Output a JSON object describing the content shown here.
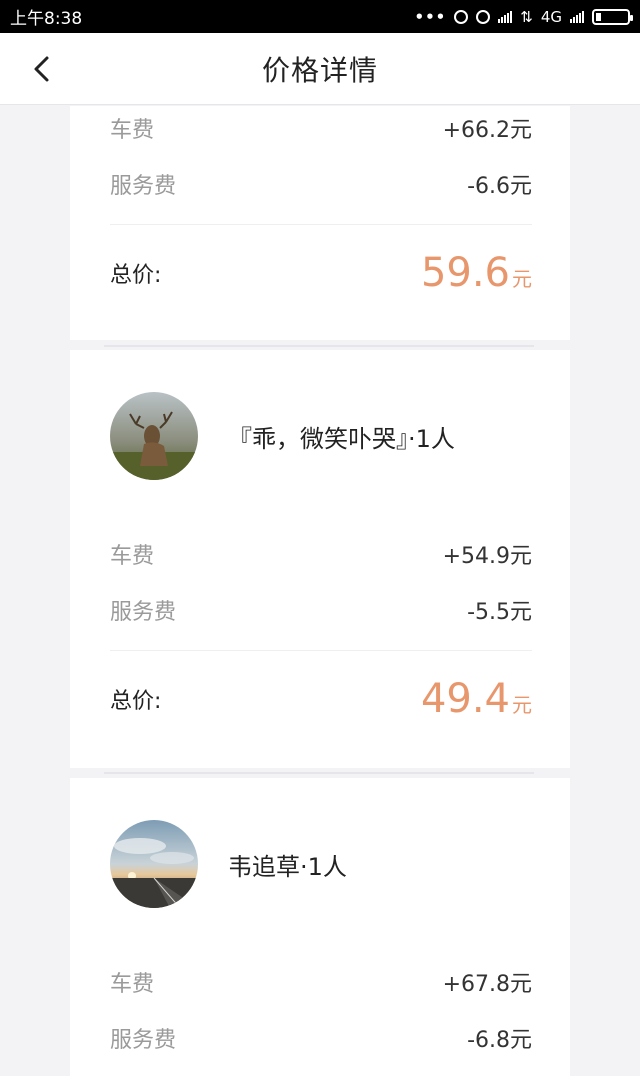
{
  "status_bar": {
    "time": "上午8:38",
    "network": "4G"
  },
  "nav": {
    "title": "价格详情"
  },
  "labels": {
    "fare": "车费",
    "service_fee": "服务费",
    "total": "总价:",
    "unit": "元"
  },
  "cards": [
    {
      "fare": "+66.2元",
      "service_fee": "-6.6元",
      "total": "59.6"
    },
    {
      "passenger": "『乖，微笑卟哭』·1人",
      "fare": "+54.9元",
      "service_fee": "-5.5元",
      "total": "49.4"
    },
    {
      "passenger": "韦追草·1人",
      "fare": "+67.8元",
      "service_fee": "-6.8元"
    }
  ],
  "colors": {
    "accent": "#e8976d",
    "label_gray": "#9a9a9a",
    "background": "#f3f3f6"
  },
  "icons": {
    "back": "chevron-left-icon",
    "avatar1": "deer-avatar",
    "avatar2": "road-sunset-avatar"
  }
}
